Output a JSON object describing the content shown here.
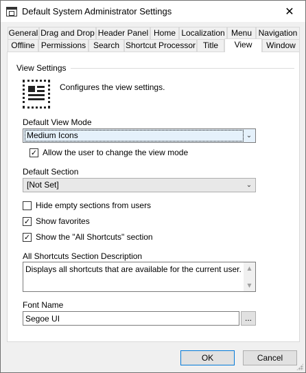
{
  "window": {
    "title": "Default System Administrator Settings",
    "close_glyph": "✕"
  },
  "tabs": {
    "row1": [
      "General",
      "Drag and Drop",
      "Header Panel",
      "Home",
      "Localization",
      "Menu",
      "Navigation"
    ],
    "row2": [
      "Offline",
      "Permissions",
      "Search",
      "Shortcut Processor",
      "Title",
      "View",
      "Window"
    ],
    "active": "View"
  },
  "view_settings": {
    "group_label": "View Settings",
    "icon": "view-settings-icon",
    "description": "Configures the view settings.",
    "default_view_mode_label": "Default View Mode",
    "default_view_mode_value": "Medium Icons",
    "allow_change_label": "Allow the user to change the view mode",
    "allow_change_checked": "✓",
    "default_section_label": "Default Section",
    "default_section_value": "[Not Set]",
    "hide_empty_label": "Hide empty sections from users",
    "hide_empty_checked": "",
    "show_favorites_label": "Show favorites",
    "show_favorites_checked": "✓",
    "show_all_shortcuts_label": "Show the \"All Shortcuts\" section",
    "show_all_shortcuts_checked": "✓",
    "all_shortcuts_desc_label": "All Shortcuts Section Description",
    "all_shortcuts_desc_value": "Displays all shortcuts that are available for the current user.",
    "font_name_label": "Font Name",
    "font_name_value": "Segoe UI",
    "browse_label": "..."
  },
  "buttons": {
    "ok": "OK",
    "cancel": "Cancel"
  },
  "glyphs": {
    "chevron_down": "⌄",
    "scroll_up": "▲",
    "scroll_down": "▼"
  }
}
